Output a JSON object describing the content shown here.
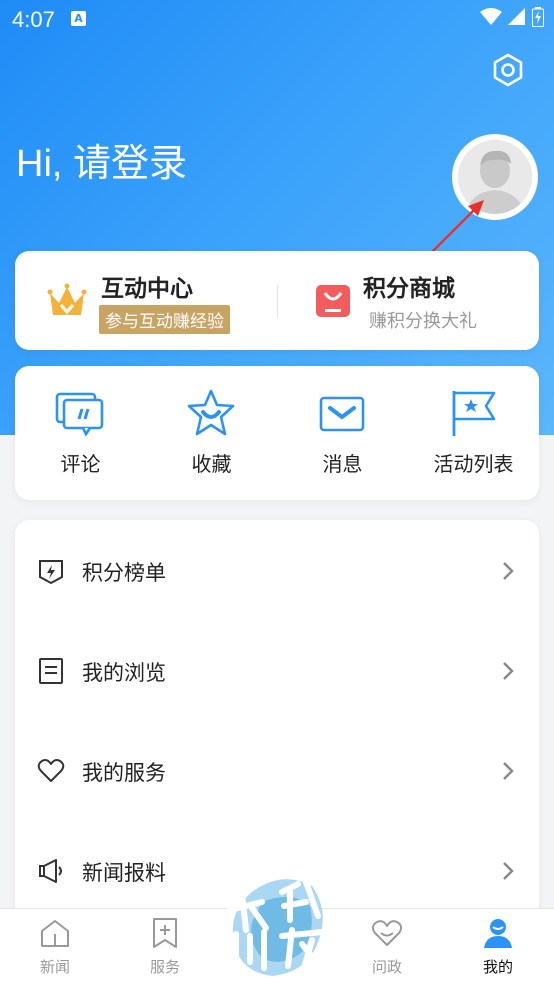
{
  "status_bar": {
    "time": "4:07",
    "notification_glyph": "A"
  },
  "header": {
    "greeting": "Hi, 请登录"
  },
  "promo": {
    "left": {
      "title": "互动中心",
      "tag": "参与互动赚经验",
      "icon": "crown-icon"
    },
    "right": {
      "title": "积分商城",
      "subtitle": "赚积分换大礼",
      "icon": "shopping-bag-icon"
    }
  },
  "quick_actions": [
    {
      "label": "评论",
      "icon": "comment-icon"
    },
    {
      "label": "收藏",
      "icon": "star-icon"
    },
    {
      "label": "消息",
      "icon": "mail-icon"
    },
    {
      "label": "活动列表",
      "icon": "flag-icon"
    }
  ],
  "menu": [
    {
      "label": "积分榜单",
      "icon": "badge-icon"
    },
    {
      "label": "我的浏览",
      "icon": "document-icon"
    },
    {
      "label": "我的服务",
      "icon": "heart-icon"
    },
    {
      "label": "新闻报料",
      "icon": "megaphone-icon"
    }
  ],
  "tabs": [
    {
      "label": "新闻",
      "icon": "home-icon",
      "active": false
    },
    {
      "label": "服务",
      "icon": "bookmark-plus-icon",
      "active": false
    },
    {
      "label": "问政",
      "icon": "heart-outline-icon",
      "active": false
    },
    {
      "label": "我的",
      "icon": "user-icon",
      "active": true
    }
  ],
  "watermark": {
    "text": "武川论坛"
  },
  "colors": {
    "brand_blue": "#2b93f7",
    "gold": "#c8a464",
    "red": "#f25c5c"
  }
}
